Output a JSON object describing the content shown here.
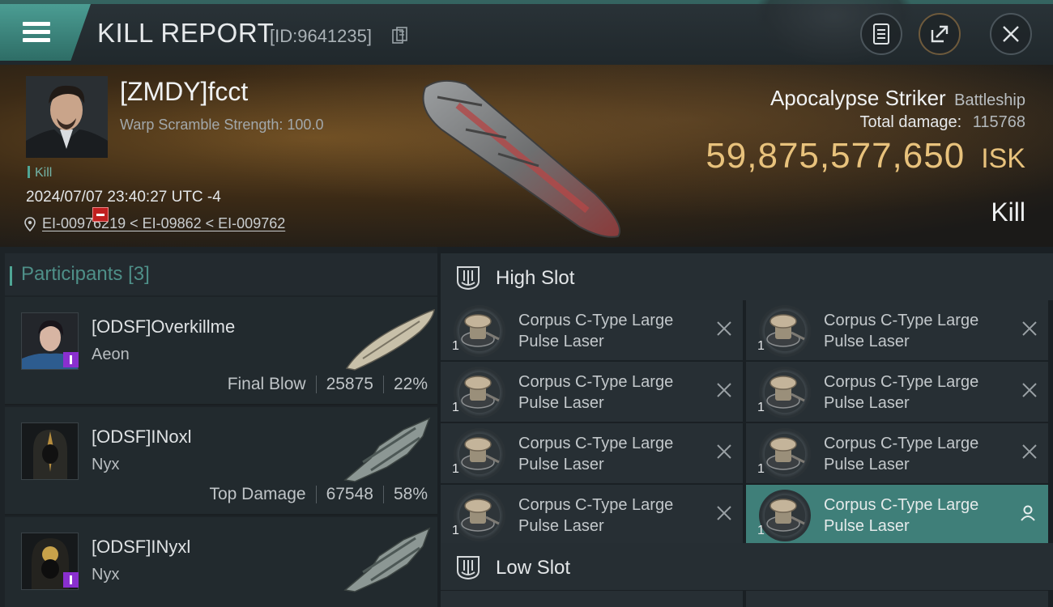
{
  "header": {
    "title": "KILL REPORT",
    "report_id": "[ID:9641235]",
    "icons": [
      "menu-icon",
      "copy-icon",
      "clipboard-icon",
      "share-icon",
      "close-icon"
    ]
  },
  "victim": {
    "name": "[ZMDY]fcct",
    "subtitle": "Warp Scramble Strength: 100.0",
    "kill_label": "Kill",
    "timestamp": "2024/07/07 23:40:27 UTC -4",
    "location": "EI-00976219 < EI-09862 < EI-009762",
    "ship": "Apocalypse Striker",
    "ship_class": "Battleship",
    "total_damage_label": "Total damage:",
    "total_damage": "115768",
    "isk_value": "59,875,577,650",
    "isk_unit": "ISK",
    "result": "Kill"
  },
  "participants": {
    "label": "Participants",
    "count": "[3]",
    "list": [
      {
        "name": "[ODSF]Overkillme",
        "ship": "Aeon",
        "tag": "Final Blow",
        "damage": "25875",
        "percent": "22%"
      },
      {
        "name": "[ODSF]INoxl",
        "ship": "Nyx",
        "tag": "Top Damage",
        "damage": "67548",
        "percent": "58%"
      },
      {
        "name": "[ODSF]INyxl",
        "ship": "Nyx",
        "tag": "",
        "damage": "",
        "percent": ""
      }
    ]
  },
  "fitting": {
    "high_slot_label": "High Slot",
    "low_slot_label": "Low Slot",
    "high_slot": [
      {
        "name": "Corpus C-Type Large Pulse Laser",
        "qty": "1"
      },
      {
        "name": "Corpus C-Type Large Pulse Laser",
        "qty": "1"
      },
      {
        "name": "Corpus C-Type Large Pulse Laser",
        "qty": "1"
      },
      {
        "name": "Corpus C-Type Large Pulse Laser",
        "qty": "1"
      },
      {
        "name": "Corpus C-Type Large Pulse Laser",
        "qty": "1"
      },
      {
        "name": "Corpus C-Type Large Pulse Laser",
        "qty": "1"
      },
      {
        "name": "Corpus C-Type Large Pulse Laser",
        "qty": "1"
      },
      {
        "name": "Corpus C-Type Large Pulse Laser",
        "qty": "1"
      }
    ]
  },
  "colors": {
    "accent": "#4fa695",
    "isk_gold": "#e8c27c",
    "security_badge": "#c01f1f",
    "faction_badge": "#8a2fcf"
  }
}
